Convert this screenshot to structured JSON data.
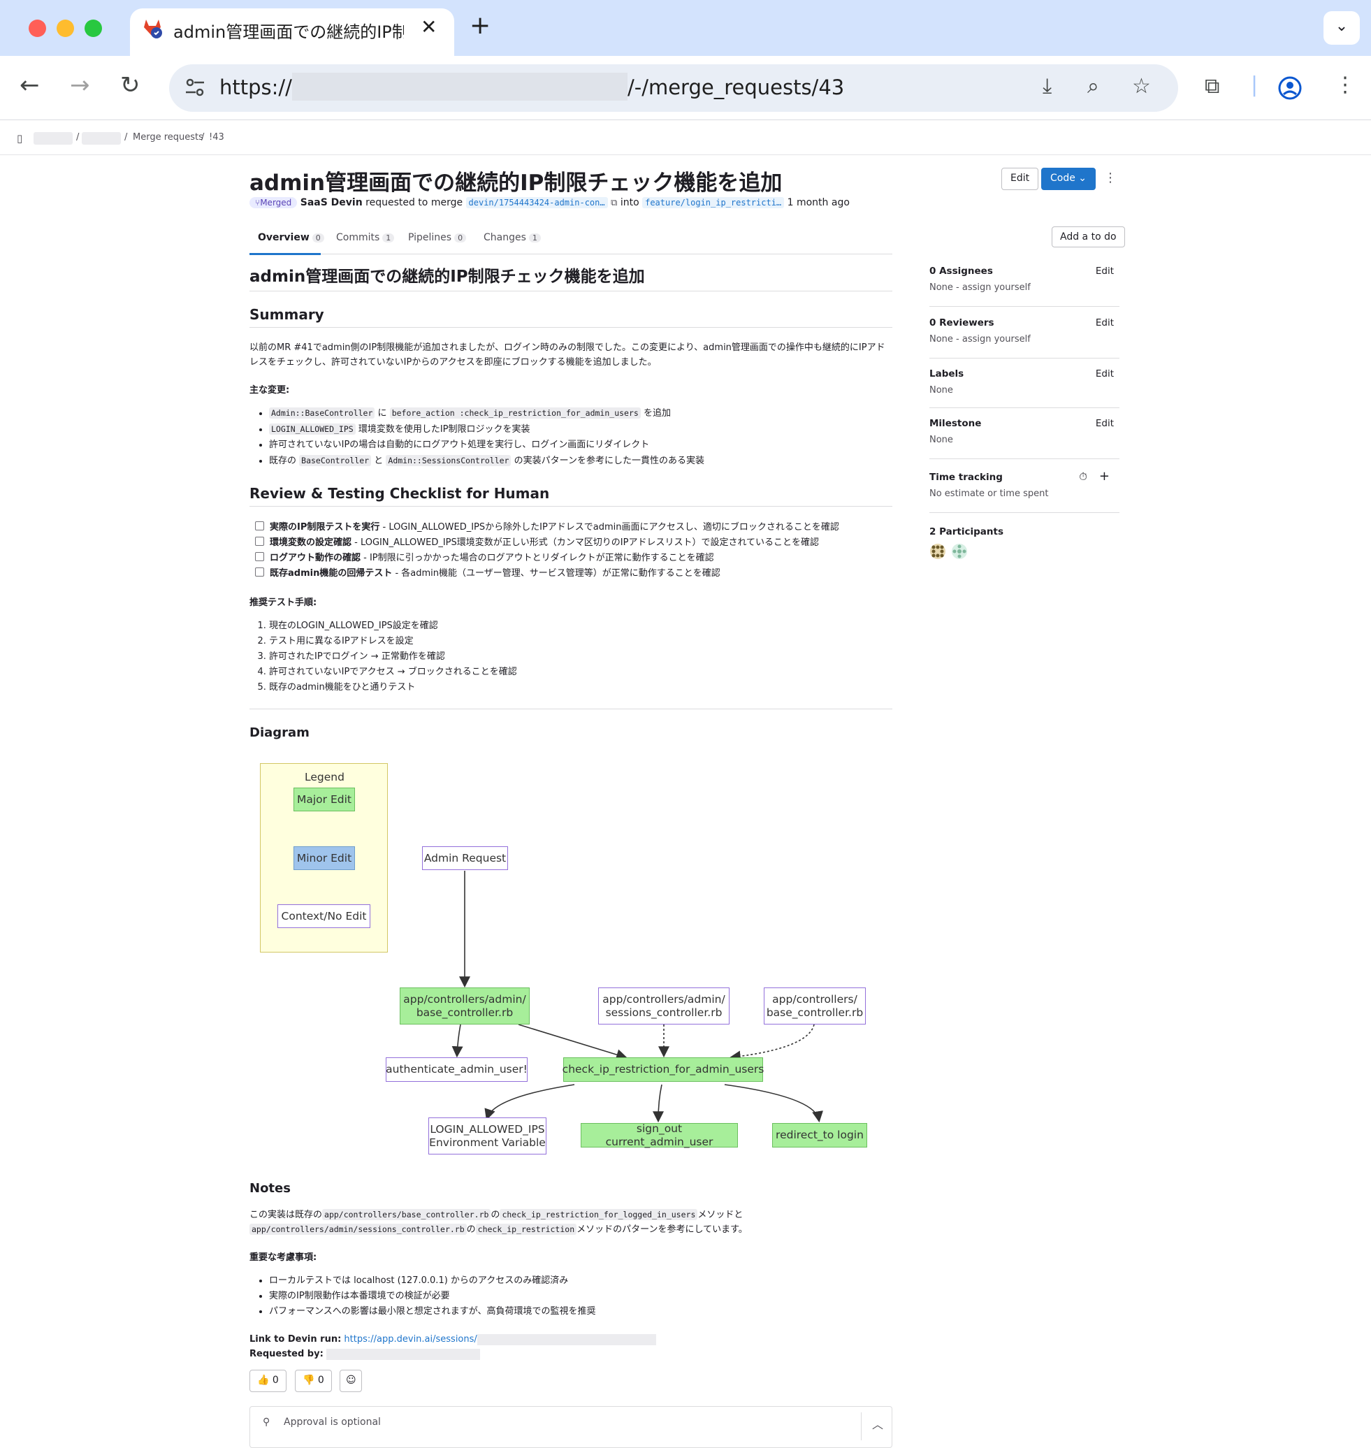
{
  "browser": {
    "tab_title": "admin管理画面での継続的IP制限",
    "url_prefix": "https://",
    "url_suffix": "/-/merge_requests/43"
  },
  "breadcrumb": {
    "merge_requests": "Merge requests",
    "current": "!43",
    "sep": "/"
  },
  "header": {
    "title": "admin管理画面での継続的IP制限チェック機能を追加",
    "edit_label": "Edit",
    "code_label": "Code",
    "status": "Merged",
    "author": "SaaS Devin",
    "requested_to_merge": "requested to merge",
    "source_branch": "devin/1754443424-admin-con…",
    "into": "into",
    "target_branch": "feature/login_ip_restricti…",
    "time": "1 month ago"
  },
  "tabs": [
    {
      "label": "Overview",
      "count": "0"
    },
    {
      "label": "Commits",
      "count": "1"
    },
    {
      "label": "Pipelines",
      "count": "0"
    },
    {
      "label": "Changes",
      "count": "1"
    }
  ],
  "add_todo": "Add a to do",
  "description": {
    "heading": "admin管理画面での継続的IP制限チェック機能を追加",
    "summary_heading": "Summary",
    "summary_text": "以前のMR #41でadmin側のIP制限機能が追加されましたが、ログイン時のみの制限でした。この変更により、admin管理画面での操作中も継続的にIPアドレスをチェックし、許可されていないIPからのアクセスを即座にブロックする機能を追加しました。",
    "main_changes_label": "主な変更:",
    "changes": [
      {
        "code1": "Admin::BaseController",
        "t1": "に",
        "code2": "before_action :check_ip_restriction_for_admin_users",
        "t2": "を追加"
      },
      {
        "code1": "LOGIN_ALLOWED_IPS",
        "t1": "環境変数を使用したIP制限ロジックを実装"
      },
      {
        "t1": "許可されていないIPの場合は自動的にログアウト処理を実行し、ログイン画面にリダイレクト"
      },
      {
        "t0": "既存の",
        "code1": "BaseController",
        "t1": "と",
        "code2": "Admin::SessionsController",
        "t2": "の実装パターンを参考にした一貫性のある実装"
      }
    ],
    "checklist_heading": "Review & Testing Checklist for Human",
    "checklist": [
      {
        "bold": "実際のIP制限テストを実行",
        "text": " - LOGIN_ALLOWED_IPSから除外したIPアドレスでadmin画面にアクセスし、適切にブロックされることを確認"
      },
      {
        "bold": "環境変数の設定確認",
        "text": " - LOGIN_ALLOWED_IPS環境変数が正しい形式（カンマ区切りのIPアドレスリスト）で設定されていることを確認"
      },
      {
        "bold": "ログアウト動作の確認",
        "text": " - IP制限に引っかかった場合のログアウトとリダイレクトが正常に動作することを確認"
      },
      {
        "bold": "既存admin機能の回帰テスト",
        "text": " - 各admin機能（ユーザー管理、サービス管理等）が正常に動作することを確認"
      }
    ],
    "test_steps_label": "推奨テスト手順:",
    "test_steps": [
      "現在のLOGIN_ALLOWED_IPS設定を確認",
      "テスト用に異なるIPアドレスを設定",
      "許可されたIPでログイン → 正常動作を確認",
      "許可されていないIPでアクセス → ブロックされることを確認",
      "既存のadmin機能をひと通りテスト"
    ],
    "diagram_heading": "Diagram",
    "notes_heading": "Notes",
    "notes_t1": "この実装は既存の",
    "notes_c1": "app/controllers/base_controller.rb",
    "notes_t2": "の",
    "notes_c2": "check_ip_restriction_for_logged_in_users",
    "notes_t3": "メソッドと",
    "notes_c3": "app/controllers/admin/sessions_controller.rb",
    "notes_t4": "の",
    "notes_c4": "check_ip_restriction",
    "notes_t5": "メソッドのパターンを参考にしています。",
    "considerations_label": "重要な考慮事項:",
    "considerations": [
      "ローカルテストでは localhost (127.0.0.1) からのアクセスのみ確認済み",
      "実際のIP制限動作は本番環境での検証が必要",
      "パフォーマンスへの影響は最小限と想定されますが、高負荷環境での監視を推奨"
    ],
    "link_label": "Link to Devin run:",
    "link_url": "https://app.devin.ai/sessions/",
    "requested_by_label": "Requested by:"
  },
  "diagram": {
    "legend_title": "Legend",
    "legend_major": "Major Edit",
    "legend_minor": "Minor Edit",
    "legend_context": "Context/No Edit",
    "admin_request": "Admin Request",
    "admin_base_l1": "app/controllers/admin/",
    "admin_base_l2": "base_controller.rb",
    "sessions_l1": "app/controllers/admin/",
    "sessions_l2": "sessions_controller.rb",
    "base_l1": "app/controllers/",
    "base_l2": "base_controller.rb",
    "authenticate": "authenticate_admin_user!",
    "check_ip": "check_ip_restriction_for_admin_users",
    "env_l1": "LOGIN_ALLOWED_IPS",
    "env_l2": "Environment Variable",
    "sign_out": "sign_out current_admin_user",
    "redirect": "redirect_to login",
    "colors": {
      "major": "#a7ee9a",
      "minor": "#9fc4ec",
      "context": "#ffffff",
      "legend_bg": "#ffffde"
    }
  },
  "sidebar": {
    "assignees_label": "0 Assignees",
    "assignees_value": "None - assign yourself",
    "reviewers_label": "0 Reviewers",
    "reviewers_value": "None - assign yourself",
    "labels_label": "Labels",
    "labels_value": "None",
    "milestone_label": "Milestone",
    "milestone_value": "None",
    "time_label": "Time tracking",
    "time_value": "No estimate or time spent",
    "participants_label": "2 Participants",
    "edit_label": "Edit"
  },
  "reactions": {
    "thumbs_up": "0",
    "thumbs_down": "0"
  },
  "approval": "Approval is optional"
}
